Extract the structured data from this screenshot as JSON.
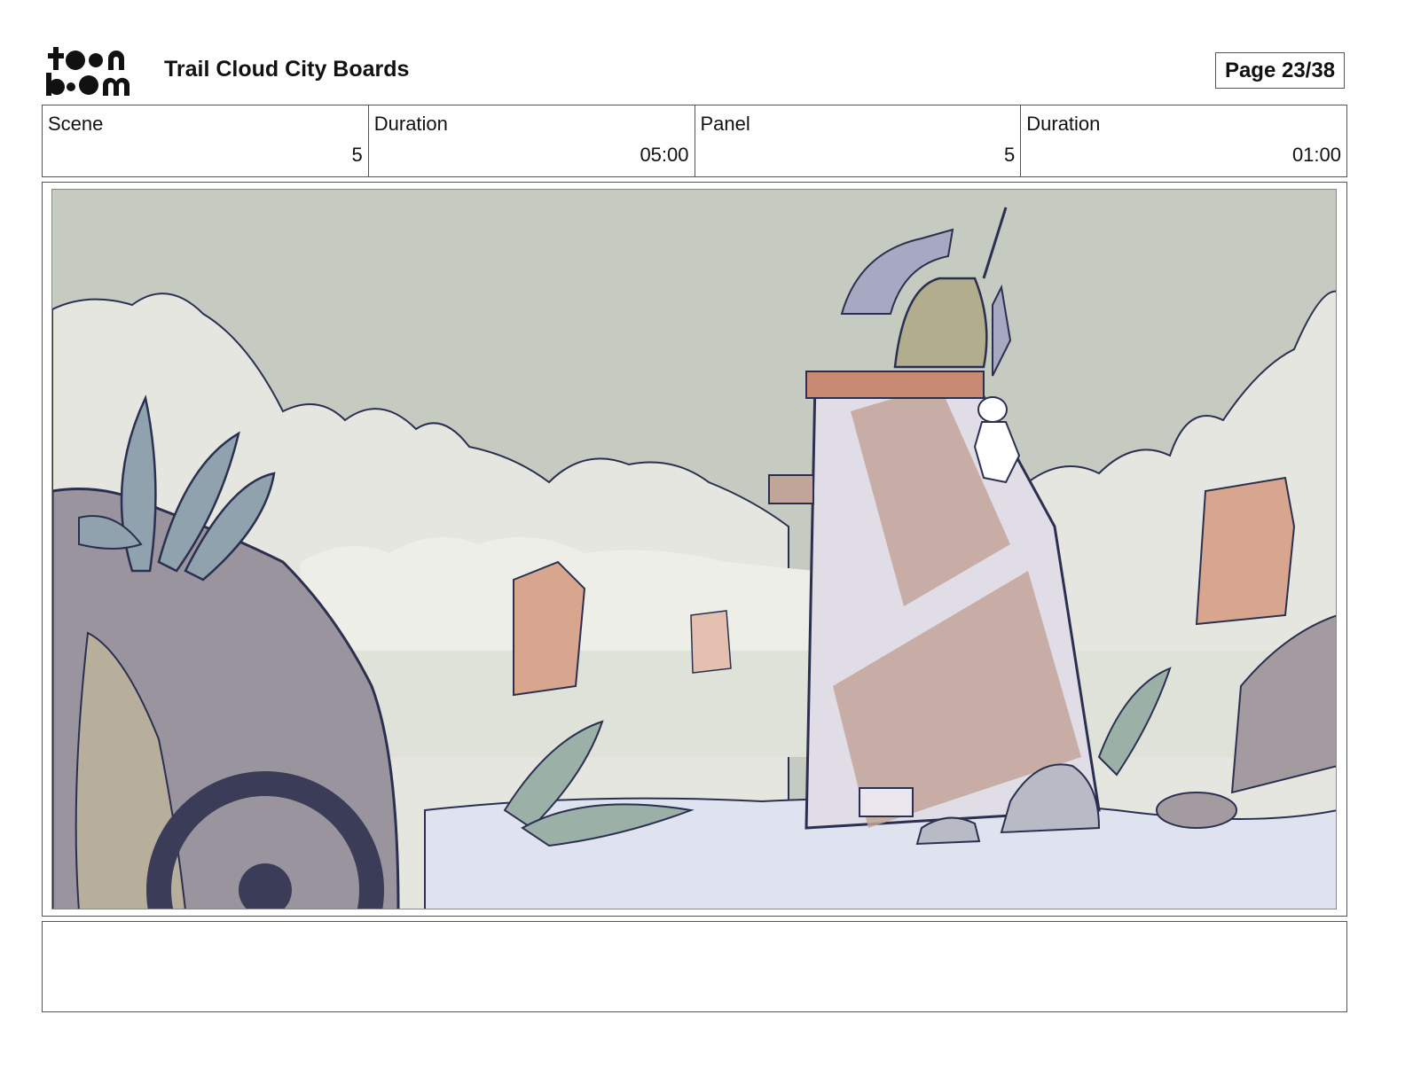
{
  "header": {
    "logo_text": "toon boom",
    "title": "Trail Cloud City Boards",
    "page": "Page 23/38"
  },
  "info": [
    {
      "label": "Scene",
      "value": "5"
    },
    {
      "label": "Duration",
      "value": "05:00"
    },
    {
      "label": "Panel",
      "value": "5"
    },
    {
      "label": "Duration",
      "value": "01:00"
    }
  ],
  "panel": {
    "image_subject": "storyboard-drawing"
  },
  "notes": {
    "text": ""
  },
  "colors": {
    "sky": "#c6cbc2",
    "cloud": "#e4e6df",
    "tower": "#e0dde6",
    "stripe": "#c2a599",
    "brick": "#d8a68f",
    "rock": "#9a949e",
    "ground": "#dfe3f0",
    "leaf": "#8fa2ae",
    "ink": "#2b3050"
  }
}
